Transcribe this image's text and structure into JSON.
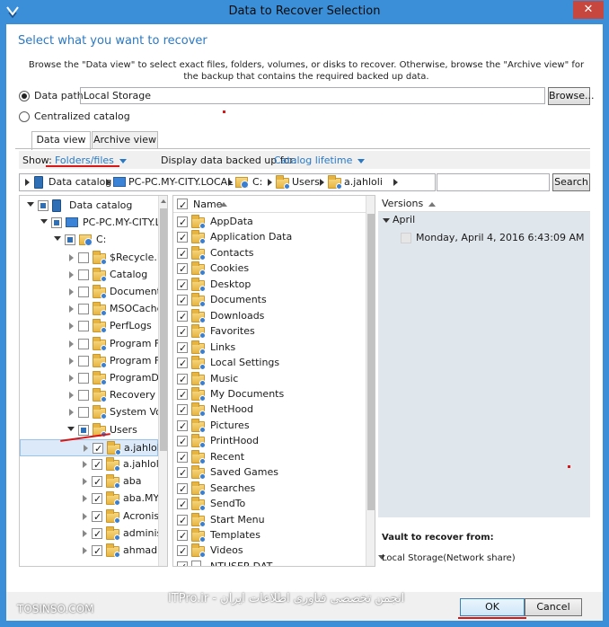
{
  "window": {
    "title": "Data to Recover Selection",
    "close_glyph": "✕"
  },
  "header": {
    "prompt": "Select what you want to recover",
    "description": "Browse the \"Data view\" to select exact files, folders, volumes, or disks to recover. Otherwise, browse the \"Archive view\" for the backup that contains the required backed up data."
  },
  "source": {
    "data_path_label": "Data path:",
    "data_path_value": "Local Storage",
    "browse_label": "Browse...",
    "centralized_label": "Centralized catalog"
  },
  "tabs": [
    {
      "label": "Data view",
      "active": true
    },
    {
      "label": "Archive view",
      "active": false
    }
  ],
  "filter": {
    "show_label": "Show:",
    "show_value": "Folders/files",
    "backed_up_label": "Display data backed up for:",
    "backed_up_value": "Catalog lifetime"
  },
  "breadcrumb": [
    "Data catalog",
    "PC-PC.MY-CITY.LOCAL",
    "C:",
    "Users",
    "a.jahloli"
  ],
  "search_label": "Search",
  "tree": [
    {
      "label": "Data catalog",
      "level": 0,
      "icon": "database-icon",
      "check": "partial",
      "expander": "open"
    },
    {
      "label": "PC-PC.MY-CITY.LO",
      "level": 1,
      "icon": "computer-icon",
      "check": "partial",
      "expander": "open"
    },
    {
      "label": "C:",
      "level": 2,
      "icon": "drive-icon",
      "check": "partial",
      "expander": "open"
    },
    {
      "label": "$Recycle.Bin",
      "level": 3,
      "icon": "folder-icon",
      "check": "none",
      "expander": "closed"
    },
    {
      "label": "Catalog",
      "level": 3,
      "icon": "folder-icon",
      "check": "none",
      "expander": "closed"
    },
    {
      "label": "Documents a",
      "level": 3,
      "icon": "folder-icon",
      "check": "none",
      "expander": "closed"
    },
    {
      "label": "MSOCache",
      "level": 3,
      "icon": "folder-icon",
      "check": "none",
      "expander": "closed"
    },
    {
      "label": "PerfLogs",
      "level": 3,
      "icon": "folder-icon",
      "check": "none",
      "expander": "closed"
    },
    {
      "label": "Program File",
      "level": 3,
      "icon": "folder-icon",
      "check": "none",
      "expander": "closed"
    },
    {
      "label": "Program File",
      "level": 3,
      "icon": "folder-icon",
      "check": "none",
      "expander": "closed"
    },
    {
      "label": "ProgramData",
      "level": 3,
      "icon": "folder-icon",
      "check": "none",
      "expander": "closed"
    },
    {
      "label": "Recovery",
      "level": 3,
      "icon": "folder-icon",
      "check": "none",
      "expander": "closed"
    },
    {
      "label": "System Volu",
      "level": 3,
      "icon": "folder-icon",
      "check": "none",
      "expander": "closed"
    },
    {
      "label": "Users",
      "level": 3,
      "icon": "folder-icon",
      "check": "partial",
      "expander": "open"
    },
    {
      "label": "a.jahloli",
      "level": 4,
      "icon": "folder-icon",
      "check": "checked",
      "expander": "closed",
      "selected": true
    },
    {
      "label": "a.jahloli.N",
      "level": 4,
      "icon": "folder-icon",
      "check": "checked",
      "expander": "closed"
    },
    {
      "label": "aba",
      "level": 4,
      "icon": "folder-icon",
      "check": "checked",
      "expander": "closed"
    },
    {
      "label": "aba.MY-C",
      "level": 4,
      "icon": "folder-icon",
      "check": "checked",
      "expander": "closed"
    },
    {
      "label": "Acronis A",
      "level": 4,
      "icon": "folder-icon",
      "check": "checked",
      "expander": "closed"
    },
    {
      "label": "administ",
      "level": 4,
      "icon": "folder-icon",
      "check": "checked",
      "expander": "closed"
    },
    {
      "label": "ahmad",
      "level": 4,
      "icon": "folder-icon",
      "check": "checked",
      "expander": "closed"
    }
  ],
  "files": {
    "name_header": "Name",
    "items": [
      "AppData",
      "Application Data",
      "Contacts",
      "Cookies",
      "Desktop",
      "Documents",
      "Downloads",
      "Favorites",
      "Links",
      "Local Settings",
      "Music",
      "My Documents",
      "NetHood",
      "Pictures",
      "PrintHood",
      "Recent",
      "Saved Games",
      "Searches",
      "SendTo",
      "Start Menu",
      "Templates",
      "Videos",
      "NTUSER.DAT"
    ]
  },
  "versions": {
    "header": "Versions",
    "group": "April",
    "entry": "Monday, April 4, 2016 6:43:09 AM",
    "vault_label": "Vault to recover from:",
    "vault_value": "Local Storage(Network share)"
  },
  "footer": {
    "watermark": "ITPro.ir - انجمن تخصصی فناوری اطلاعات ایران",
    "watermark_left": "TOSINSO.COM",
    "ok_label": "OK",
    "cancel_label": "Cancel"
  },
  "colors": {
    "accent": "#2b79c4",
    "titlebar": "#3a8fd8",
    "annotation": "#d81818"
  }
}
